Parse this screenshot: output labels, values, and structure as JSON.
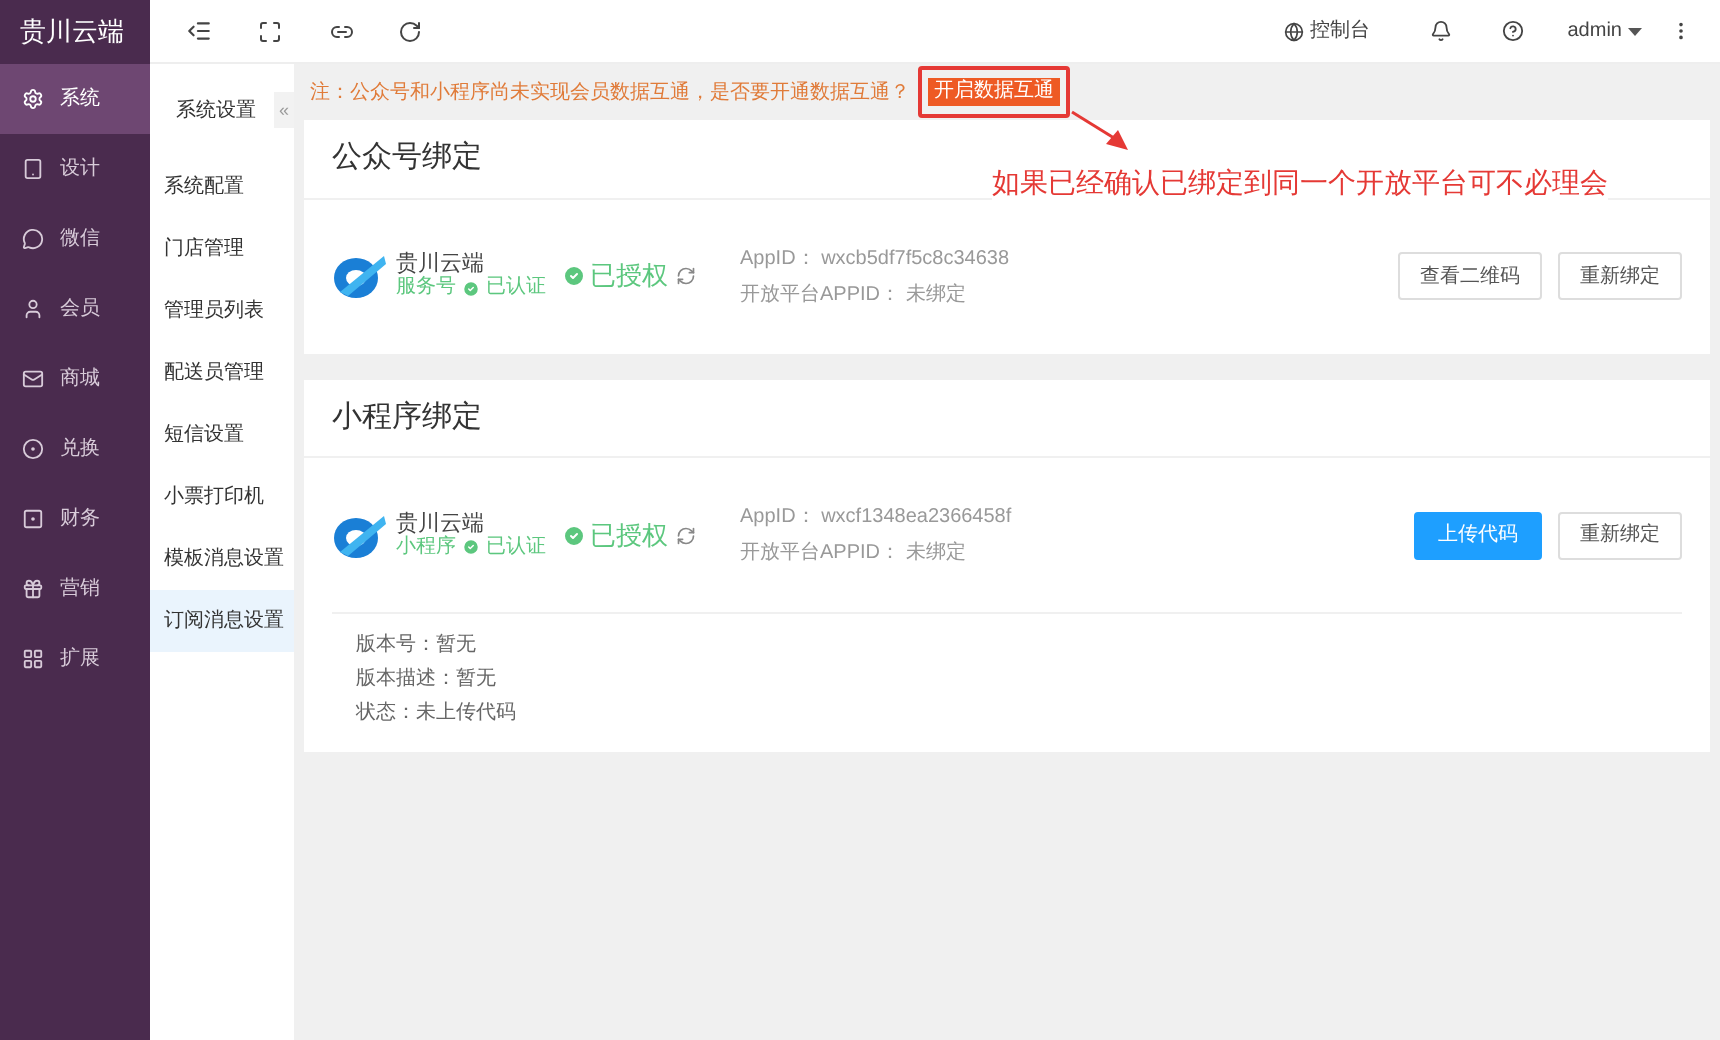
{
  "brand": "贵川云端",
  "sidebar": {
    "items": [
      {
        "label": "系统",
        "selected": true
      },
      {
        "label": "设计",
        "selected": false
      },
      {
        "label": "微信",
        "selected": false
      },
      {
        "label": "会员",
        "selected": false
      },
      {
        "label": "商城",
        "selected": false
      },
      {
        "label": "兑换",
        "selected": false
      },
      {
        "label": "财务",
        "selected": false
      },
      {
        "label": "营销",
        "selected": false
      },
      {
        "label": "扩展",
        "selected": false
      }
    ]
  },
  "submenu": {
    "title": "系统设置",
    "collapse": "«",
    "items": [
      {
        "label": "系统配置",
        "selected": false
      },
      {
        "label": "门店管理",
        "selected": false
      },
      {
        "label": "管理员列表",
        "selected": false
      },
      {
        "label": "配送员管理",
        "selected": false
      },
      {
        "label": "短信设置",
        "selected": false
      },
      {
        "label": "小票打印机",
        "selected": false
      },
      {
        "label": "模板消息设置",
        "selected": false
      },
      {
        "label": "订阅消息设置",
        "selected": true
      }
    ]
  },
  "topbar": {
    "console": "控制台",
    "user": "admin"
  },
  "notice": {
    "text": "注：公众号和小程序尚未实现会员数据互通，是否要开通数据互通？",
    "button": "开启数据互通"
  },
  "annotation": {
    "text": "如果已经确认已绑定到同一个开放平台可不必理会"
  },
  "cards": [
    {
      "title": "公众号绑定",
      "name": "贵川云端",
      "type_tag": "服务号",
      "verified": "已认证",
      "authorized": "已授权",
      "appid": "AppID： wxcb5df7f5c8c34638",
      "open_appid": "开放平台APPID： 未绑定",
      "buttons": [
        {
          "label": "查看二维码",
          "kind": "default"
        },
        {
          "label": "重新绑定",
          "kind": "default"
        }
      ]
    },
    {
      "title": "小程序绑定",
      "name": "贵川云端",
      "type_tag": "小程序",
      "verified": "已认证",
      "authorized": "已授权",
      "appid": "AppID： wxcf1348ea2366458f",
      "open_appid": "开放平台APPID： 未绑定",
      "buttons": [
        {
          "label": "上传代码",
          "kind": "primary"
        },
        {
          "label": "重新绑定",
          "kind": "default"
        }
      ],
      "details": [
        "版本号：暂无",
        "版本描述：暂无",
        "状态：未上传代码"
      ]
    }
  ]
}
